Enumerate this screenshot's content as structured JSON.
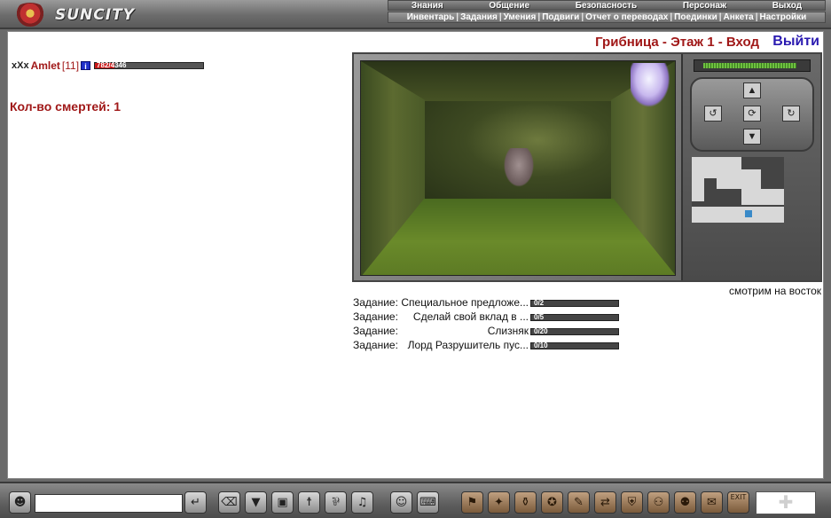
{
  "app": {
    "logo_text": "SUNCITY"
  },
  "top_nav": [
    "Знания",
    "Общение",
    "Безопасность",
    "Персонаж",
    "Выход"
  ],
  "sub_nav": [
    "Инвентарь",
    "Задания",
    "Умения",
    "Подвиги",
    "Отчет о переводах",
    "Поединки",
    "Анкета",
    "Настройки"
  ],
  "location": {
    "title": "Грибница - Этаж 1 - Вход",
    "exit_label": "Выйти",
    "look_direction": "смотрим на восток"
  },
  "player": {
    "clan_marker": "xXx",
    "name": "Amlet",
    "level": "[11]",
    "info_label": "i",
    "hp_current": 782,
    "hp_max": 4346,
    "hp_text": "782/4346"
  },
  "deaths": "Кол-во смертей: 1",
  "tasks": [
    {
      "label": "Задание:",
      "name": "Специальное предложе...",
      "progress_text": "0/2",
      "progress": 0
    },
    {
      "label": "Задание:",
      "name": "Сделай свой вклад в ...",
      "progress_text": "0/5",
      "progress": 0
    },
    {
      "label": "Задание:",
      "name": "Слизняк",
      "progress_text": "0/20",
      "progress": 0
    },
    {
      "label": "Задание:",
      "name": "Лорд Разрушитель пус...",
      "progress_text": "0/10",
      "progress": 0
    }
  ],
  "compass": {
    "forward_icon": "arrow-up-icon",
    "turn_left_icon": "turn-left-icon",
    "turn_right_icon": "turn-right-icon",
    "back_icon": "arrow-down-icon"
  },
  "energy": 0.94,
  "toolbar": {
    "chat_placeholder": "",
    "exit_icon_text": "EXIT",
    "puzzle_icon": "puzzle-icon"
  },
  "colors": {
    "title_red": "#a01818",
    "exit_blue": "#2a1ab0",
    "hp_red": "#c81818"
  }
}
